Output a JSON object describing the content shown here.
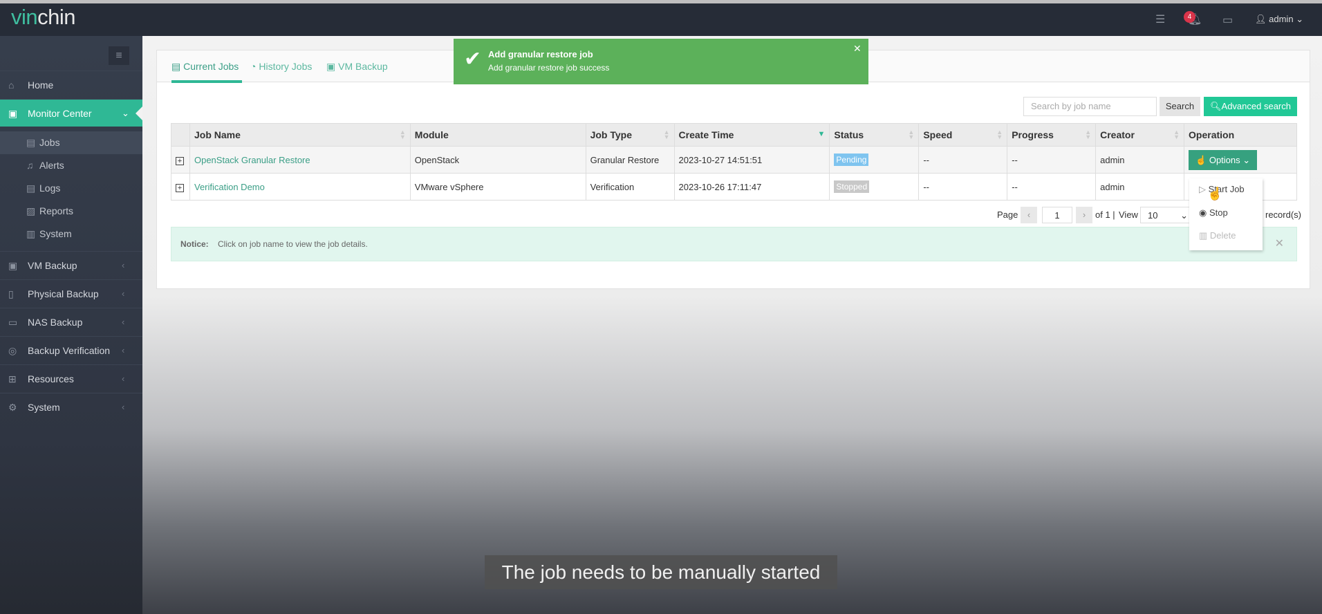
{
  "app": {
    "logo": "vinchin",
    "notification_count": "4",
    "user": "admin"
  },
  "sidebar": {
    "items": [
      {
        "label": "Home",
        "icon": "home-icon"
      },
      {
        "label": "Monitor Center",
        "icon": "monitor-icon",
        "active": true
      },
      {
        "label": "VM Backup",
        "icon": "vm-icon"
      },
      {
        "label": "Physical Backup",
        "icon": "server-icon"
      },
      {
        "label": "NAS Backup",
        "icon": "nas-icon"
      },
      {
        "label": "Backup Verification",
        "icon": "shield-icon"
      },
      {
        "label": "Resources",
        "icon": "grid-icon"
      },
      {
        "label": "System",
        "icon": "gear-icon"
      }
    ],
    "sub_items": [
      {
        "label": "Jobs",
        "active": true
      },
      {
        "label": "Alerts"
      },
      {
        "label": "Logs"
      },
      {
        "label": "Reports"
      },
      {
        "label": "System"
      }
    ]
  },
  "tabs": [
    {
      "label": "Current Jobs",
      "active": true
    },
    {
      "label": "History Jobs"
    },
    {
      "label": "VM Backup"
    }
  ],
  "search": {
    "placeholder": "Search by job name",
    "button": "Search",
    "advanced": "Advanced search"
  },
  "table": {
    "columns": [
      "Job Name",
      "Module",
      "Job Type",
      "Create Time",
      "Status",
      "Speed",
      "Progress",
      "Creator",
      "Operation"
    ],
    "rows": [
      {
        "name": "OpenStack Granular Restore",
        "module": "OpenStack",
        "type": "Granular Restore",
        "time": "2023-10-27 14:51:51",
        "status": "Pending",
        "status_color": "#7fc4ef",
        "speed": "--",
        "progress": "--",
        "creator": "admin",
        "operation": "Options"
      },
      {
        "name": "Verification Demo",
        "module": "VMware vSphere",
        "type": "Verification",
        "time": "2023-10-26 17:11:47",
        "status": "Stopped",
        "status_color": "#c8c8c8",
        "speed": "--",
        "progress": "--",
        "creator": "admin"
      }
    ]
  },
  "pagination": {
    "page_label": "Page",
    "page": "1",
    "of": "of 1 |",
    "view_label": "View",
    "view": "10",
    "records": "record(s)"
  },
  "dropdown": {
    "items": [
      "Start Job",
      "Stop",
      "Delete"
    ]
  },
  "notice": {
    "label": "Notice:",
    "text": "Click on job name to view the job details."
  },
  "toast": {
    "title": "Add granular restore job",
    "message": "Add granular restore job success"
  },
  "subtitle": "The job needs to be manually started",
  "colors": {
    "accent": "#2fb895",
    "toast": "#5cb15a",
    "sidebar": "#363e4c",
    "topbar": "#262c37"
  }
}
